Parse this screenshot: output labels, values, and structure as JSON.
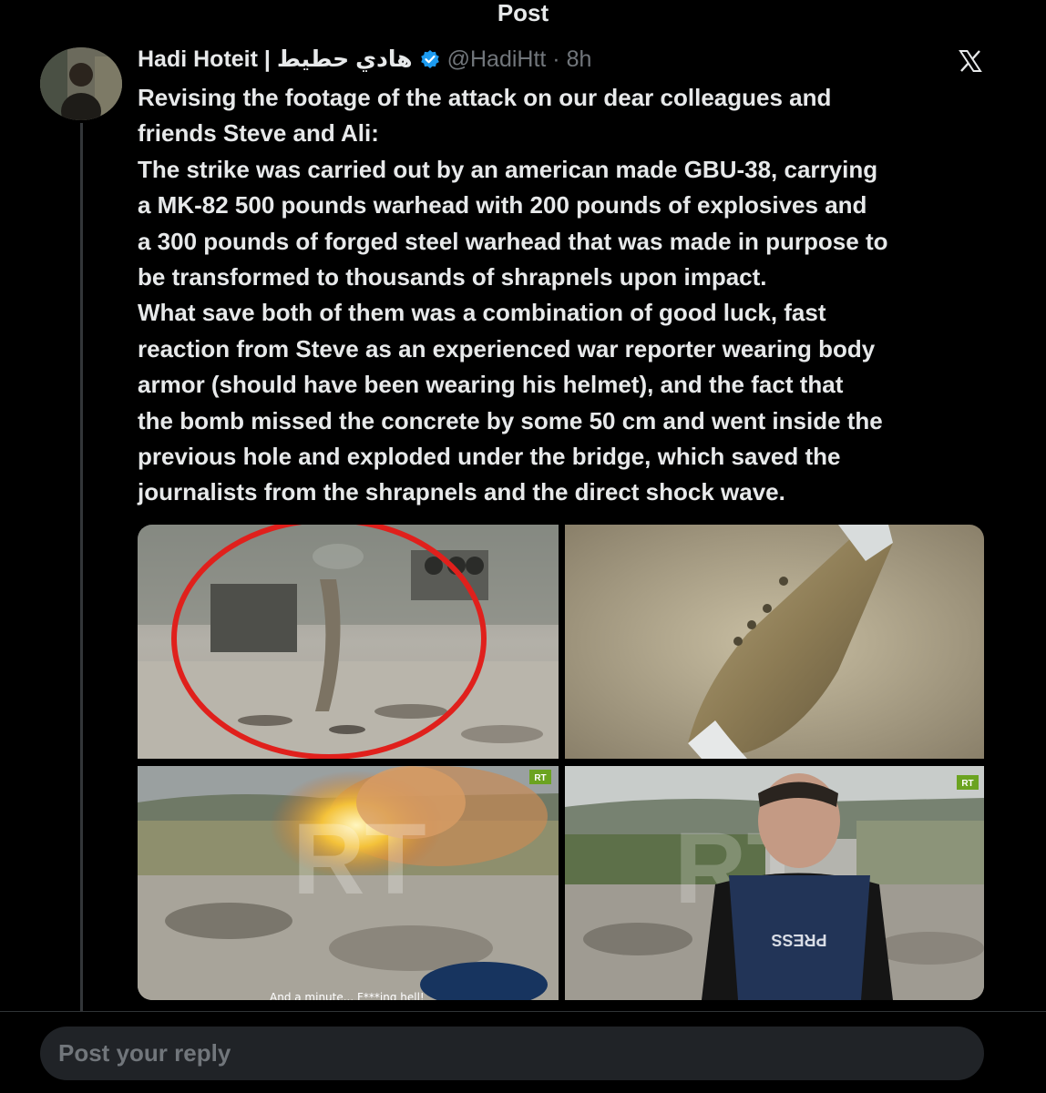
{
  "header": {
    "title": "Post"
  },
  "post": {
    "author_name": "Hadi Hoteit | هادي حطيط",
    "handle_time": "@HadiHtt · 8h",
    "text": "Revising the footage of the attack on our dear colleagues and\nfriends Steve and Ali:\nThe strike was carried out by an american made GBU-38, carrying\na MK-82 500 pounds warhead with 200 pounds of explosives and\na 300 pounds of forged steel warhead that was made in purpose to\nbe transformed to thousands of shrapnels upon impact.\nWhat save both of them was a combination of good luck, fast\nreaction from Steve as an experienced war reporter wearing body\narmor (should have been wearing his helmet), and the fact that\nthe bomb missed the concrete by some 50 cm and went inside the\nprevious hole and exploded under the bridge, which saved the\njournalists from the shrapnels and the direct shock wave.",
    "media": {
      "caption": "And a minute... F***ing hell!",
      "watermark": "RT",
      "logo": "RT",
      "vest_label": "PRESS"
    }
  },
  "reply": {
    "placeholder": "Post your reply"
  },
  "colors": {
    "background": "#000000",
    "text": "#e7e9ea",
    "muted": "#71767b",
    "verified": "#1d9bf0",
    "highlight_circle": "#e0201c"
  },
  "icons": {
    "verified": "verified-badge-icon",
    "brand": "x-logo-icon"
  }
}
